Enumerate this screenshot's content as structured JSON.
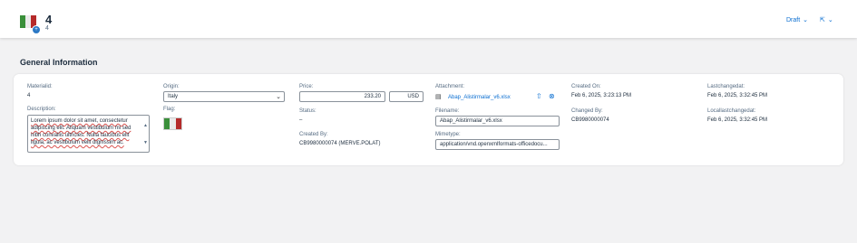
{
  "header": {
    "title": "4",
    "subtitle": "4",
    "badge": "+",
    "draft_label": "Draft",
    "draft_chevron": "⌄",
    "share_icon": "⇱",
    "share_chevron": "⌄"
  },
  "section": {
    "title": "General Information"
  },
  "fields": {
    "materialid": {
      "label": "Materialid:",
      "value": "4"
    },
    "description": {
      "label": "Description:",
      "value": "Lorem ipsum dolor sit amet, consectetur adipiscing elit. Aliquam vestibulum mi sed nibh convallis ultricies. Nulla faucibus elit ligula, ac vestibulum velit dignissim ac."
    },
    "origin": {
      "label": "Origin:",
      "value": "Italy",
      "arrow": "⌄"
    },
    "flag": {
      "label": "Flag:"
    },
    "price": {
      "label": "Price:",
      "value": "233.20",
      "currency": "USD"
    },
    "status": {
      "label": "Status:",
      "value": "–"
    },
    "created_by": {
      "label": "Created By:",
      "value": "CB9980000074 (MERVE.POLAT)"
    },
    "attachment": {
      "label": "Attachment:",
      "value": "Abap_Alistirmalar_v6.xlsx",
      "file_icon": "▤",
      "upload_icon": "⇧",
      "remove_icon": "⊗"
    },
    "filename": {
      "label": "Filename:",
      "value": "Abap_Alistirmalar_v6.xlsx"
    },
    "mimetype": {
      "label": "Mimetype:",
      "value": "application/vnd.openxmlformats-officedocu..."
    },
    "created_on": {
      "label": "Created On:",
      "value": "Feb 6, 2025, 3:23:13 PM"
    },
    "changed_by": {
      "label": "Changed By:",
      "value": "CB9980000074"
    },
    "lastchangedat": {
      "label": "Lastchangedat:",
      "value": "Feb 6, 2025, 3:32:45 PM"
    },
    "locallastchangedat": {
      "label": "Locallastchangedat:",
      "value": "Feb 6, 2025, 3:32:45 PM"
    }
  },
  "colors": {
    "flag_green": "#3a8f3a",
    "flag_white": "#eaeaea",
    "flag_red": "#b52a2a",
    "accent": "#0a6ed1"
  }
}
